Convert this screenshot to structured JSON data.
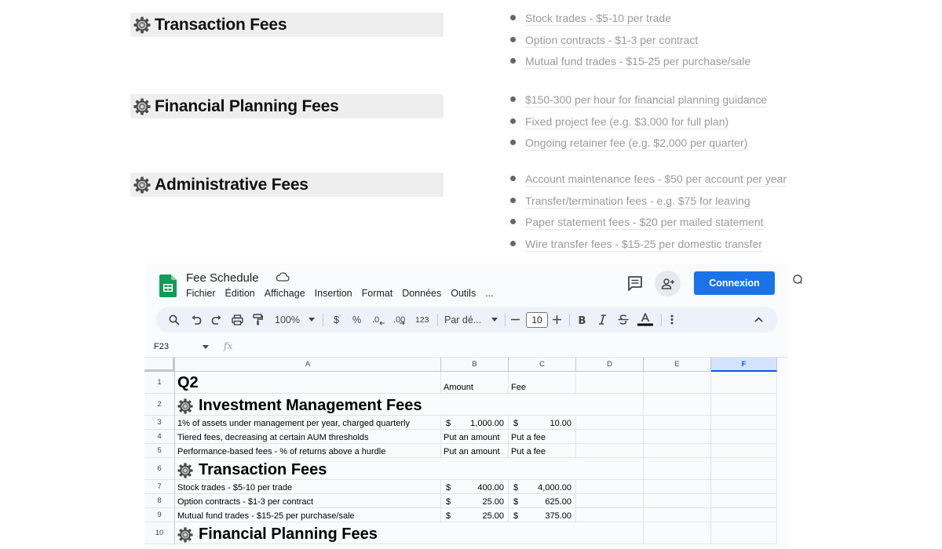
{
  "doc": {
    "sections": [
      {
        "title": "Transaction Fees",
        "items": [
          "Stock trades - $5-10 per trade",
          "Option contracts - $1-3 per contract",
          "Mutual fund trades - $15-25 per purchase/sale"
        ]
      },
      {
        "title": "Financial Planning Fees",
        "items": [
          "$150-300 per hour for financial planning guidance",
          "Fixed project fee (e.g. $3,000 for full plan)",
          "Ongoing retainer fee (e.g. $2,000 per quarter)"
        ]
      },
      {
        "title": "Administrative Fees",
        "items": [
          "Account maintenance fees - $50 per account per year",
          "Transfer/termination fees - e.g. $75 for leaving",
          "Paper statement fees - $20 per mailed statement",
          "Wire transfer fees - $15-25 per domestic transfer"
        ]
      }
    ]
  },
  "sheets": {
    "title": "Fee Schedule",
    "menu": [
      "Fichier",
      "Édition",
      "Affichage",
      "Insertion",
      "Format",
      "Données",
      "Outils",
      "..."
    ],
    "connect_label": "Connexion",
    "toolbar": {
      "zoom": "100%",
      "currency": "$",
      "percent": "%",
      "dec_decrease": ".0",
      "dec_increase": ".00",
      "number_format": "123",
      "font": "Par dé...",
      "font_size": "10"
    },
    "name_box": "F23",
    "fx_label": "fx",
    "selected_column": "F",
    "columns": [
      "A",
      "B",
      "C",
      "D",
      "E",
      "F"
    ],
    "rows": [
      {
        "n": "1",
        "type": "title",
        "a": "Q2",
        "b": "Amount",
        "c": "Fee"
      },
      {
        "n": "2",
        "type": "section",
        "a": "Investment Management Fees"
      },
      {
        "n": "3",
        "type": "money",
        "a": "1% of assets under management per year, charged quarterly",
        "b_cur": "$",
        "b": "1,000.00",
        "c_cur": "$",
        "c": "10.00"
      },
      {
        "n": "4",
        "type": "text",
        "a": "Tiered fees, decreasing at certain AUM thresholds",
        "b": "Put an amount",
        "c": "Put a fee"
      },
      {
        "n": "5",
        "type": "text",
        "a": "Performance-based fees - % of returns above a hurdle",
        "b": "Put an amount",
        "c": "Put a fee"
      },
      {
        "n": "6",
        "type": "section",
        "a": "Transaction Fees"
      },
      {
        "n": "7",
        "type": "money",
        "a": "Stock trades - $5-10 per trade",
        "b_cur": "$",
        "b": "400.00",
        "c_cur": "$",
        "c": "4,000.00"
      },
      {
        "n": "8",
        "type": "money",
        "a": "Option contracts - $1-3 per contract",
        "b_cur": "$",
        "b": "25.00",
        "c_cur": "$",
        "c": "625.00"
      },
      {
        "n": "9",
        "type": "money",
        "a": "Mutual fund trades - $15-25 per purchase/sale",
        "b_cur": "$",
        "b": "25.00",
        "c_cur": "$",
        "c": "375.00"
      },
      {
        "n": "10",
        "type": "section",
        "a": "Financial Planning Fees"
      }
    ]
  }
}
